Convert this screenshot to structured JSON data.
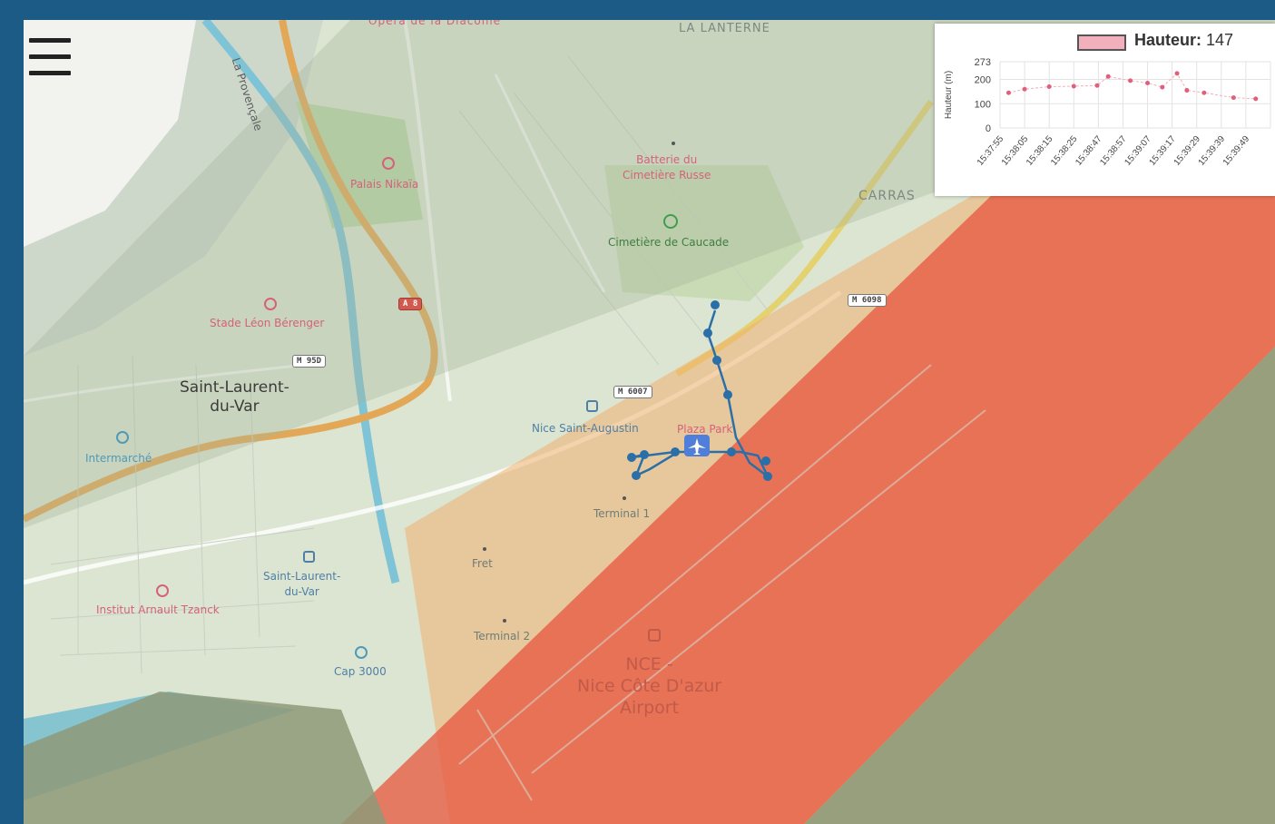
{
  "map": {
    "streets": {
      "provencale": "La Provençale",
      "lanterne": "LA LANTERNE",
      "carras": "CARRAS",
      "opera": "Opéra de la Diaconie"
    },
    "places": {
      "saint_laurent": "Saint-Laurent-\ndu-Var"
    },
    "poi": {
      "palais_nikaia": "Palais Nikaïa",
      "stade_leon": "Stade Léon Bérenger",
      "batterie": "Batterie du\nCimetière Russe",
      "cimetiere": "Cimetière de Caucade",
      "intermarche": "Intermarché",
      "institut": "Institut Arnault Tzanck",
      "nice_saint_augustin": "Nice Saint-Augustin",
      "saint_laurent_station": "Saint-Laurent-\ndu-Var",
      "cap3000": "Cap 3000",
      "terminal1": "Terminal 1",
      "terminal2": "Terminal 2",
      "fret": "Fret",
      "plaza": "Plaza Park",
      "airport": "NCE -\nNice Côte D'azur\nAirport"
    },
    "shields": {
      "a8": "A 8",
      "m95d": "M 95D",
      "m6007": "M 6007",
      "m6098": "M 6098"
    },
    "colors": {
      "red_zone": "#e8553e",
      "orange_zone": "#f0b070",
      "sea_overlay": "#8e9a79",
      "track": "#2a6fa8"
    },
    "icons": {
      "menu": "hamburger-icon",
      "airport_marker": "airplane-icon"
    }
  },
  "chart_data": {
    "type": "scatter",
    "legend": {
      "label": "Hauteur:",
      "value": "147"
    },
    "ylabel": "Hauteur (m)",
    "yticks": [
      "273",
      "200",
      "100",
      "0"
    ],
    "ylim": [
      0,
      273
    ],
    "categories": [
      "15:37:55",
      "15:38:05",
      "15:38:15",
      "15:38:25",
      "15:38:47",
      "15:38:57",
      "15:39:07",
      "15:39:17",
      "15:39:29",
      "15:39:39",
      "15:39:49"
    ],
    "series": [
      {
        "name": "Hauteur",
        "color": "#f2b0bd",
        "points": [
          {
            "x": 0.35,
            "y": 145
          },
          {
            "x": 1.0,
            "y": 160
          },
          {
            "x": 2.0,
            "y": 170
          },
          {
            "x": 3.0,
            "y": 172
          },
          {
            "x": 3.95,
            "y": 175
          },
          {
            "x": 4.4,
            "y": 212
          },
          {
            "x": 5.3,
            "y": 195
          },
          {
            "x": 6.0,
            "y": 185
          },
          {
            "x": 6.6,
            "y": 168
          },
          {
            "x": 7.2,
            "y": 225
          },
          {
            "x": 7.6,
            "y": 155
          },
          {
            "x": 8.3,
            "y": 145
          },
          {
            "x": 9.5,
            "y": 125
          },
          {
            "x": 10.4,
            "y": 120
          }
        ]
      }
    ]
  }
}
